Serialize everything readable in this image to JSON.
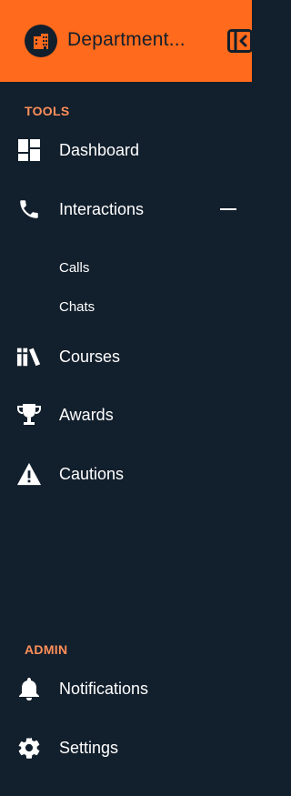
{
  "header": {
    "department_name": "Department...",
    "avatar_icon": "building-icon",
    "collapse_icon": "sidebar-collapse-icon",
    "background_color": "#ff6a1c"
  },
  "sections": {
    "tools_label": "TOOLS",
    "admin_label": "ADMIN"
  },
  "nav": {
    "dashboard": {
      "label": "Dashboard",
      "icon": "dashboard-icon"
    },
    "interactions": {
      "label": "Interactions",
      "icon": "phone-icon",
      "expanded": true,
      "sub_items": [
        "Calls",
        "Chats"
      ]
    },
    "courses": {
      "label": "Courses",
      "icon": "books-icon"
    },
    "awards": {
      "label": "Awards",
      "icon": "trophy-icon"
    },
    "cautions": {
      "label": "Cautions",
      "icon": "warning-icon"
    },
    "notifications": {
      "label": "Notifications",
      "icon": "bell-icon"
    },
    "settings": {
      "label": "Settings",
      "icon": "gear-icon"
    }
  },
  "colors": {
    "sidebar_bg": "#121f2c",
    "accent": "#ff6a1c",
    "section_label": "#ff8f5a"
  }
}
